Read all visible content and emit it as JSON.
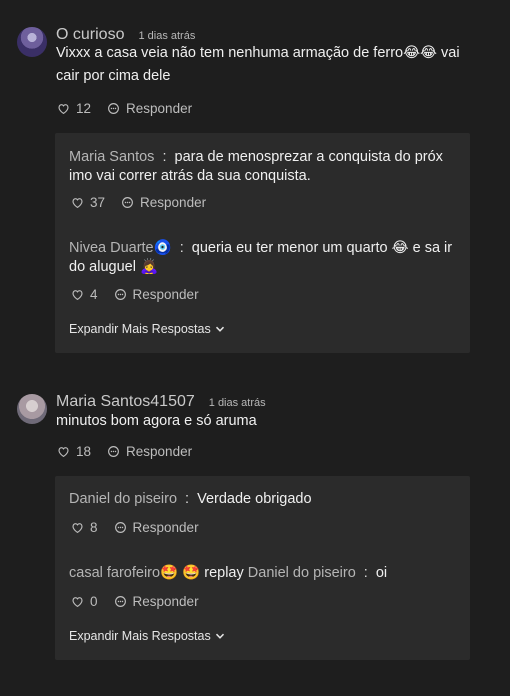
{
  "comments": [
    {
      "author": "O curioso",
      "time": "1 dias atrás",
      "text": "Vixxx a casa veia não tem nenhuma armação de ferro😂😂 vai cair por cima dele",
      "likes": "12",
      "reply_label": "Responder",
      "replies": [
        {
          "author": "Maria Santos",
          "text": "para de menosprezar a conquista do próx imo vai correr atrás da sua conquista.",
          "likes": "37",
          "reply_label": "Responder"
        },
        {
          "author": "Nivea Duarte🧿",
          "text": "queria eu ter menor um quarto 😂 e sa ir do aluguel 🙇‍♀️",
          "likes": "4",
          "reply_label": "Responder"
        }
      ],
      "expand_label": "Expandir Mais Respostas"
    },
    {
      "author": "Maria Santos41507",
      "time": "1 dias atrás",
      "text": "minutos bom agora e só aruma",
      "likes": "18",
      "reply_label": "Responder",
      "replies": [
        {
          "author": "Daniel do piseiro",
          "text": "Verdade obrigado",
          "likes": "8",
          "reply_label": "Responder"
        },
        {
          "author": "casal farofeiro🤩 🤩",
          "reply_word": "replay",
          "reply_to": "Daniel do piseiro",
          "text": "oi",
          "likes": "0",
          "reply_label": "Responder"
        }
      ],
      "expand_label": "Expandir Mais Respostas"
    }
  ],
  "colors": {
    "background": "#1e1e1e",
    "reply_box": "#2b2b2b",
    "muted_text": "#b5b5b5"
  },
  "icons": {
    "like": "heart-outline-icon",
    "reply": "speech-bubble-icon",
    "expand": "chevron-down-icon"
  }
}
